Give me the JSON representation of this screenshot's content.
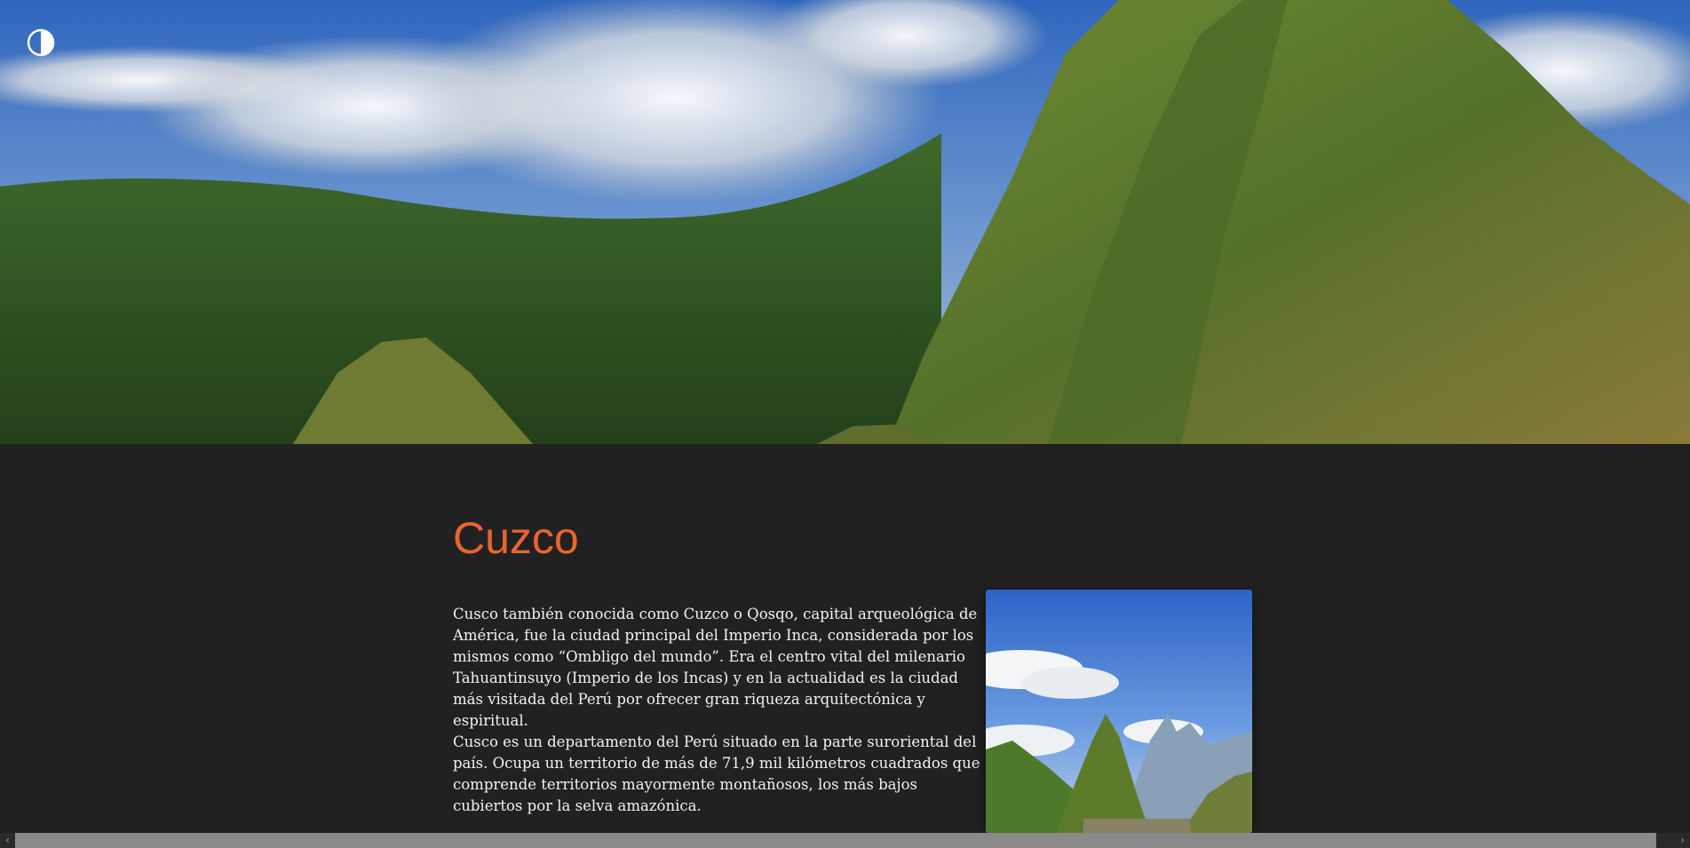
{
  "theme_toggle": {
    "icon": "half-circle-contrast-icon"
  },
  "hero": {
    "image": "mountain-landscape-photo"
  },
  "article": {
    "title": "Cuzco",
    "paragraphs": [
      "Cusco también conocida como Cuzco o Qosqo, capital arqueológica de América, fue la ciudad principal del Imperio Inca, considerada por los mismos como “Ombligo del mundo”. Era el centro vital del milenario Tahuantinsuyo (Imperio de los Incas) y en la actualidad es la ciudad más visitada del Perú por ofrecer gran riqueza arquitectónica y espiritual.",
      "Cusco es un departamento del Perú situado en la parte suroriental del país. Ocupa un territorio de más de 71,9 mil kilómetros cuadrados que comprende territorios mayormente montañosos, los más bajos cubiertos por la selva amazónica."
    ],
    "image": "machu-picchu-photo"
  },
  "scrollbar": {
    "left_arrow": "‹",
    "right_arrow": "›"
  },
  "colors": {
    "accent": "#e8652f",
    "background": "#212121",
    "text": "#f2f2f2"
  }
}
